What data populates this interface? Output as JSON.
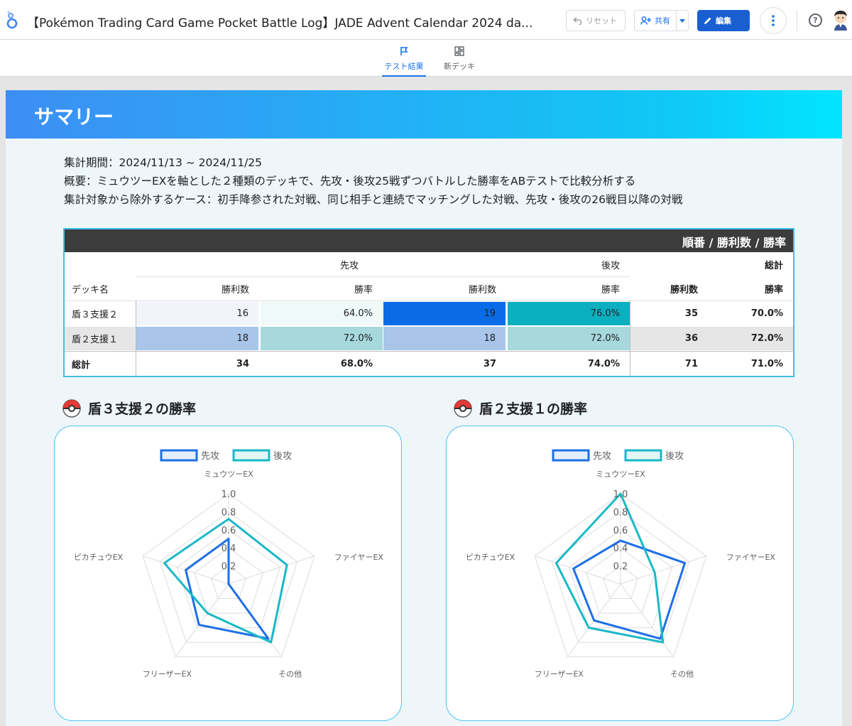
{
  "topbar": {
    "title": "【Pokémon Trading Card Game Pocket Battle Log】JADE Advent Calendar 2024 da...",
    "reset_label": "リセット",
    "share_label": "共有",
    "edit_label": "編集"
  },
  "page_tabs": [
    {
      "label": "テスト結果",
      "icon": "flag-icon",
      "active": true
    },
    {
      "label": "新デッキ",
      "icon": "dashboard-icon",
      "active": false
    }
  ],
  "report": {
    "banner_title": "サマリー",
    "period": "集計期間：2024/11/13 ~ 2024/11/25",
    "overview": "概要：ミュウツーEXを軸とした２種類のデッキで、先攻・後攻25戦ずつバトルした勝率をABテストで比較分析する",
    "exclusions": "集計対象から除外するケース：初手降参された対戦、同じ相手と連続でマッチングした対戦、先攻・後攻の26戦目以降の対戦"
  },
  "table": {
    "header": "順番 / 勝利数 / 勝率",
    "group_first": "先攻",
    "group_second": "後攻",
    "group_total": "総計",
    "col_deck": "デッキ名",
    "col_wins": "勝利数",
    "col_rate": "勝率",
    "rows": [
      {
        "deck": "盾３支援２",
        "first_wins": "16",
        "first_rate": "64.0%",
        "second_wins": "19",
        "second_rate": "76.0%",
        "total_wins": "35",
        "total_rate": "70.0%"
      },
      {
        "deck": "盾２支援１",
        "first_wins": "18",
        "first_rate": "72.0%",
        "second_wins": "18",
        "second_rate": "72.0%",
        "total_wins": "36",
        "total_rate": "72.0%"
      }
    ],
    "total_row": {
      "deck": "総計",
      "first_wins": "34",
      "first_rate": "68.0%",
      "second_wins": "37",
      "second_rate": "74.0%",
      "total_wins": "71",
      "total_rate": "71.0%"
    }
  },
  "sections": [
    {
      "title": "盾３支援２の勝率"
    },
    {
      "title": "盾２支援１の勝率"
    }
  ],
  "colors": {
    "first_series": "#1e6fe6",
    "second_series": "#1ab8c8",
    "accent": "#1a73e8"
  },
  "chart_data": [
    {
      "type": "radar",
      "axes": [
        "ミュウツーEX",
        "ファイヤーEX",
        "その他",
        "フリーザーEX",
        "ピカチュウEX"
      ],
      "ticks": [
        "0.2",
        "0.4",
        "0.6",
        "0.8",
        "1.0"
      ],
      "range": [
        0,
        1
      ],
      "legend_position": "top",
      "series": [
        {
          "name": "先攻",
          "values": [
            0.5,
            0.0,
            0.75,
            0.56,
            0.5
          ]
        },
        {
          "name": "後攻",
          "values": [
            0.72,
            0.68,
            0.8,
            0.4,
            0.75
          ]
        }
      ]
    },
    {
      "type": "radar",
      "axes": [
        "ミュウツーEX",
        "ファイヤーEX",
        "その他",
        "フリーザーEX",
        "ピカチュウEX"
      ],
      "ticks": [
        "0.2",
        "0.4",
        "0.6",
        "0.8",
        "1.0"
      ],
      "range": [
        0,
        1
      ],
      "legend_position": "top",
      "series": [
        {
          "name": "先攻",
          "values": [
            0.48,
            0.75,
            0.75,
            0.5,
            0.55
          ]
        },
        {
          "name": "後攻",
          "values": [
            1.0,
            0.4,
            0.8,
            0.6,
            0.75
          ]
        }
      ]
    }
  ]
}
